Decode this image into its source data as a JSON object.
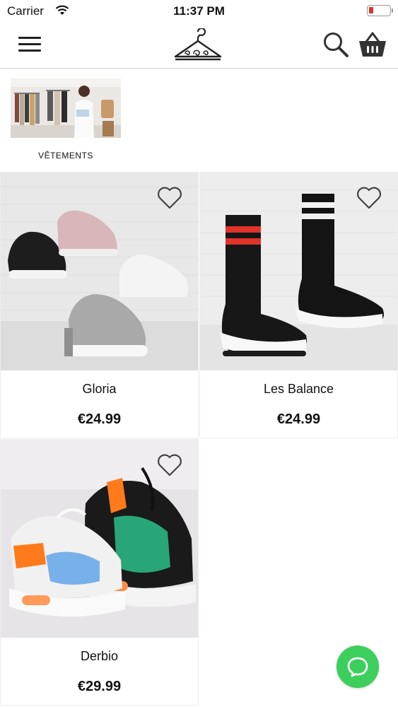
{
  "status_bar": {
    "carrier": "Carrier",
    "time": "11:37 PM"
  },
  "nav": {
    "icons": [
      "menu-icon",
      "hanger-logo-icon",
      "search-icon",
      "basket-icon"
    ]
  },
  "categories": [
    {
      "label": "VÊTEMENTS"
    }
  ],
  "products": [
    {
      "name": "Gloria",
      "price": "€24.99"
    },
    {
      "name": "Les Balance",
      "price": "€24.99"
    },
    {
      "name": "Derbio",
      "price": "€29.99"
    }
  ],
  "colors": {
    "accent_chat": "#3ccf5c",
    "battery_low": "#e0302a"
  }
}
